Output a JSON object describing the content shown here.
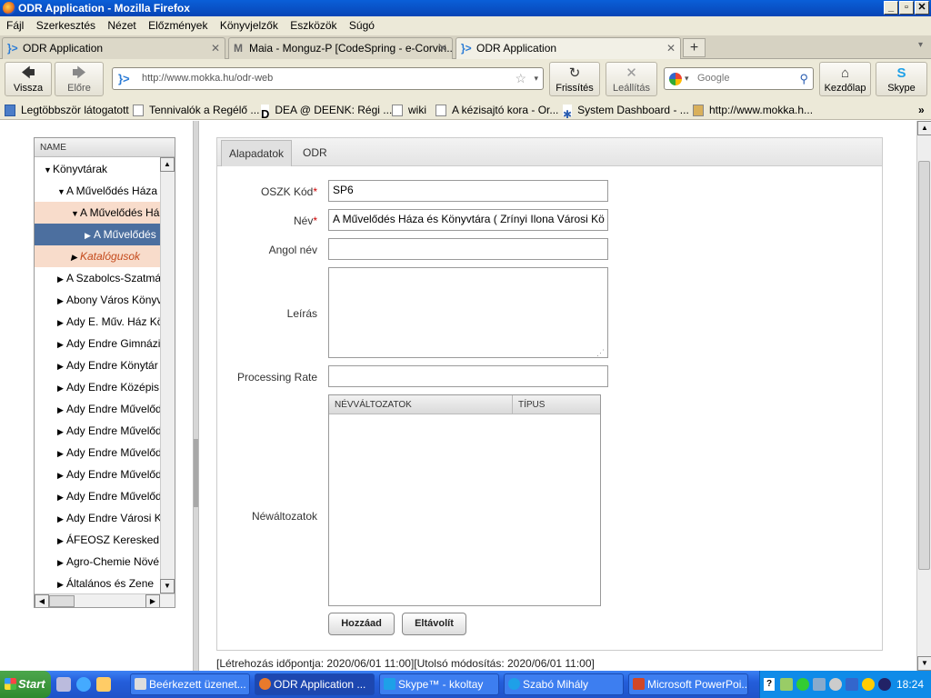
{
  "window": {
    "title": "ODR Application - Mozilla Firefox"
  },
  "menu": [
    "Fájl",
    "Szerkesztés",
    "Nézet",
    "Előzmények",
    "Könyvjelzők",
    "Eszközök",
    "Súgó"
  ],
  "tabs": [
    {
      "label": "ODR Application"
    },
    {
      "label": "Maia - Monguz-P [CodeSpring - e-Corvin..."
    },
    {
      "label": "ODR Application"
    }
  ],
  "nav": {
    "back": "Vissza",
    "forward": "Előre",
    "reload": "Frissítés",
    "stop": "Leállítás",
    "home": "Kezdőlap",
    "skype": "Skype",
    "url": "http://www.mokka.hu/odr-web",
    "search_placeholder": "Google"
  },
  "bookmarks": [
    "Legtöbbször látogatott",
    "Tennivalók a Regélő ...",
    "DEA @ DEENK: Régi ...",
    "wiki",
    "A kézisajtó kora - Or...",
    "System Dashboard - ...",
    "http://www.mokka.h..."
  ],
  "tree": {
    "header": "NAME",
    "rows": [
      {
        "label": "Könyvtárak",
        "state": "open"
      },
      {
        "label": "A Művelődés Háza",
        "state": "open"
      },
      {
        "label": "A Művelődés Há",
        "state": "open"
      },
      {
        "label": "A Művelődés",
        "state": "closed"
      },
      {
        "label": "Katalógusok",
        "state": "closed"
      },
      {
        "label": "A Szabolcs-Szatmá",
        "state": "closed"
      },
      {
        "label": "Abony Város Könyv",
        "state": "closed"
      },
      {
        "label": "Ady E. Műv. Ház Kö",
        "state": "closed"
      },
      {
        "label": "Ady Endre Gimnázi",
        "state": "closed"
      },
      {
        "label": "Ady Endre Könytár",
        "state": "closed"
      },
      {
        "label": "Ady Endre Középis",
        "state": "closed"
      },
      {
        "label": "Ady Endre Művelőd",
        "state": "closed"
      },
      {
        "label": "Ady Endre Művelőd",
        "state": "closed"
      },
      {
        "label": "Ady Endre Művelőd",
        "state": "closed"
      },
      {
        "label": "Ady Endre Művelőd",
        "state": "closed"
      },
      {
        "label": "Ady Endre Művelőd",
        "state": "closed"
      },
      {
        "label": "Ady Endre Városi K",
        "state": "closed"
      },
      {
        "label": "ÁFEOSZ Keresked",
        "state": "closed"
      },
      {
        "label": "Agro-Chemie Növé",
        "state": "closed"
      },
      {
        "label": "Általános és Zene",
        "state": "closed"
      }
    ]
  },
  "form": {
    "tabs": [
      "Alapadatok",
      "ODR"
    ],
    "oszk_label": "OSZK Kód",
    "oszk_value": "SP6",
    "name_label": "Név",
    "name_value": "A Művelődés Háza és Könyvtára ( Zrínyi Ilona Városi Kö",
    "english_label": "Angol név",
    "english_value": "",
    "desc_label": "Leírás",
    "desc_value": "",
    "rate_label": "Processing Rate",
    "rate_value": "",
    "variants_label": "Néwáltozatok",
    "grid_headers": [
      "NÉVVÁLTOZATOK",
      "TÍPUS"
    ],
    "add_button": "Hozzáad",
    "remove_button": "Eltávolít",
    "required_marker": "*"
  },
  "footer": "[Létrehozás időpontja: 2020/06/01 11:00][Utolsó módosítás: 2020/06/01 11:00]",
  "taskbar": {
    "start": "Start",
    "tasks": [
      "Beérkezett üzenet...",
      "ODR Application ...",
      "Skype™ - kkoltay",
      "Szabó Mihály",
      "Microsoft PowerPoi..."
    ],
    "clock": "18:24"
  }
}
